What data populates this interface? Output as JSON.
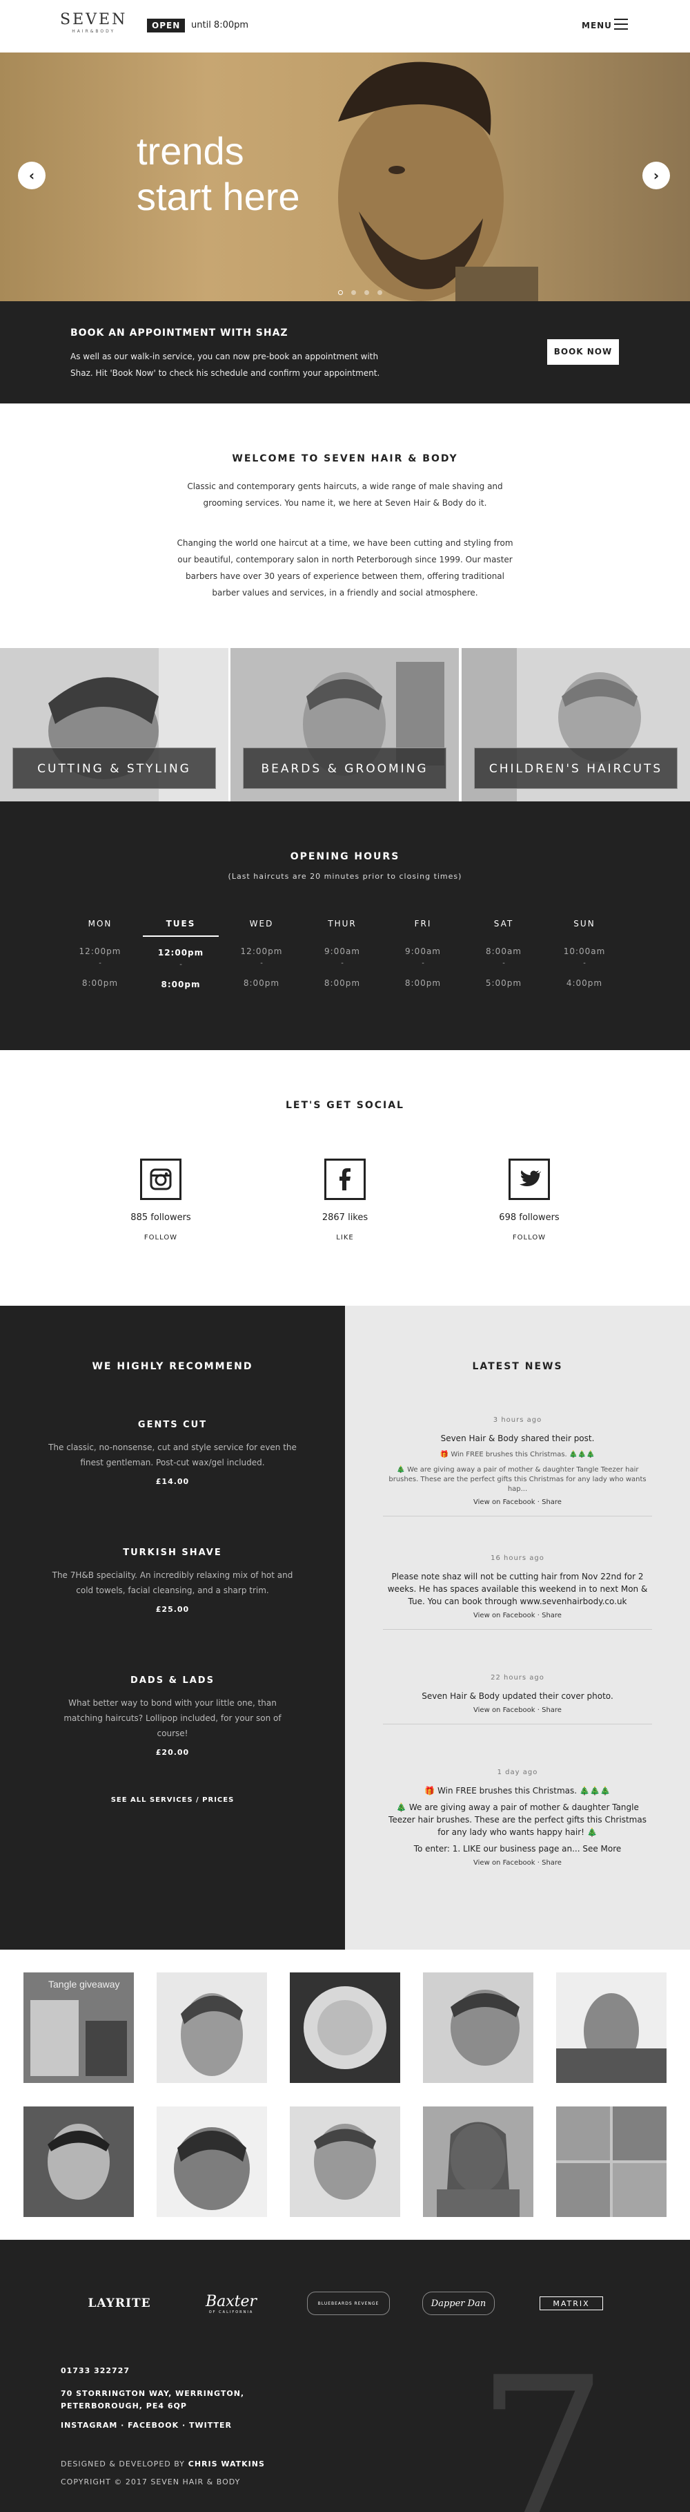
{
  "header": {
    "logo_main": "SEVEN",
    "logo_sub": "HAIR&BODY",
    "open_badge": "OPEN",
    "open_until": "until 8:00pm",
    "menu_label": "MENU"
  },
  "hero": {
    "line1": "trends",
    "line2": "start here",
    "prev_arrow": "‹",
    "next_arrow": "›",
    "slide_count": 4,
    "active_slide": 1
  },
  "book": {
    "title": "BOOK AN APPOINTMENT WITH SHAZ",
    "text": "As well as our walk-in service, you can now pre-book an appointment with Shaz. Hit 'Book Now' to check his schedule and confirm your appointment.",
    "button": "BOOK NOW"
  },
  "welcome": {
    "title": "WELCOME TO SEVEN HAIR & BODY",
    "para1": "Classic and contemporary gents haircuts, a wide range of male shaving and grooming services. You name it, we here at Seven Hair & Body do it.",
    "para2": "Changing the world one haircut at a time, we have been cutting and styling from our beautiful, contemporary salon in north Peterborough since 1999. Our master barbers have over 30 years of experience between them, offering traditional barber values and services, in a friendly and social atmosphere."
  },
  "tiles": [
    {
      "label": "CUTTING & STYLING"
    },
    {
      "label": "BEARDS & GROOMING"
    },
    {
      "label": "CHILDREN'S HAIRCUTS"
    }
  ],
  "hours": {
    "title": "OPENING HOURS",
    "subtitle": "(Last haircuts are 20 minutes prior to closing times)",
    "separator": "-",
    "days": [
      {
        "name": "MON",
        "open": "12:00pm",
        "close": "8:00pm"
      },
      {
        "name": "TUES",
        "open": "12:00pm",
        "close": "8:00pm"
      },
      {
        "name": "WED",
        "open": "12:00pm",
        "close": "8:00pm"
      },
      {
        "name": "THUR",
        "open": "9:00am",
        "close": "8:00pm"
      },
      {
        "name": "FRI",
        "open": "9:00am",
        "close": "8:00pm"
      },
      {
        "name": "SAT",
        "open": "8:00am",
        "close": "5:00pm"
      },
      {
        "name": "SUN",
        "open": "10:00am",
        "close": "4:00pm"
      }
    ],
    "active_day": "TUES"
  },
  "social": {
    "title": "LET'S GET SOCIAL",
    "items": [
      {
        "icon": "instagram-icon",
        "count": "885 followers",
        "action": "FOLLOW"
      },
      {
        "icon": "facebook-icon",
        "count": "2867 likes",
        "action": "LIKE"
      },
      {
        "icon": "twitter-icon",
        "count": "698 followers",
        "action": "FOLLOW"
      }
    ]
  },
  "recommend": {
    "title": "WE HIGHLY RECOMMEND",
    "services": [
      {
        "name": "GENTS CUT",
        "desc": "The classic, no-nonsense, cut and style service for even the finest gentleman. Post-cut wax/gel included.",
        "price": "£14.00"
      },
      {
        "name": "TURKISH SHAVE",
        "desc": "The 7H&B speciality. An incredibly relaxing mix of hot and cold towels, facial cleansing, and a sharp trim.",
        "price": "£25.00"
      },
      {
        "name": "DADS & LADS",
        "desc": "What better way to bond with your little one, than matching haircuts? Lollipop included, for your son of course!",
        "price": "£20.00"
      }
    ],
    "see_all": "SEE ALL SERVICES / PRICES"
  },
  "news": {
    "title": "LATEST NEWS",
    "posts": [
      {
        "ago": "3 hours ago",
        "body": "Seven Hair & Body shared their post.",
        "extra": "🎁 Win FREE brushes this Christmas. 🎄🎄🎄",
        "small": "🎄 We are giving away a pair of mother & daughter Tangle Teezer hair brushes. These are the perfect gifts this Christmas for any lady who wants hap...",
        "links": "View on Facebook · Share"
      },
      {
        "ago": "16 hours ago",
        "body": "Please note shaz will not be cutting hair from Nov 22nd for 2 weeks. He has spaces available this weekend in to next Mon & Tue. You can book through www.sevenhairbody.co.uk",
        "extra": "",
        "small": "",
        "links": "View on Facebook · Share"
      },
      {
        "ago": "22 hours ago",
        "body": "Seven Hair & Body updated their cover photo.",
        "extra": "",
        "small": "",
        "links": "View on Facebook · Share"
      },
      {
        "ago": "1 day ago",
        "body": "🎁 Win FREE brushes this Christmas. 🎄🎄🎄",
        "extra": "🎄 We are giving away a pair of mother & daughter Tangle Teezer hair brushes. These are the perfect gifts this Christmas for any lady who wants happy hair! 🎄",
        "small": "To enter: 1. LIKE our business page an... See More",
        "links": "View on Facebook · Share"
      }
    ]
  },
  "grid": {
    "caption": "Tangle giveaway"
  },
  "footer": {
    "brands": [
      "LAYRITE",
      "Baxter",
      "BLUEBEARDS REVENGE",
      "Dapper Dan",
      "MATRIX"
    ],
    "brand_sub": "OF CALIFORNIA",
    "phone": "01733 322727",
    "address": "70 STORRINGTON WAY, WERRINGTON, PETERBOROUGH, PE4 6QP",
    "social_links": "INSTAGRAM · FACEBOOK · TWITTER",
    "designed_prefix": "DESIGNED & DEVELOPED BY",
    "designer": "CHRIS WATKINS",
    "copyright": "COPYRIGHT © 2017 SEVEN HAIR & BODY",
    "watermark": "7"
  },
  "colors": {
    "dark": "#222222",
    "hero_tan": "#c7a672",
    "news_bg": "#e9e9e9"
  }
}
